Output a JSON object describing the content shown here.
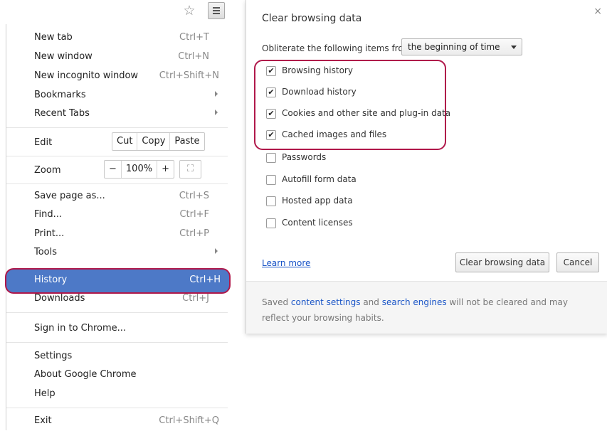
{
  "menu": {
    "items_top": [
      {
        "label": "New tab",
        "shortcut": "Ctrl+T"
      },
      {
        "label": "New window",
        "shortcut": "Ctrl+N"
      },
      {
        "label": "New incognito window",
        "shortcut": "Ctrl+Shift+N"
      },
      {
        "label": "Bookmarks",
        "shortcut": ""
      },
      {
        "label": "Recent Tabs",
        "shortcut": ""
      }
    ],
    "edit": {
      "label": "Edit",
      "cut": "Cut",
      "copy": "Copy",
      "paste": "Paste"
    },
    "zoom": {
      "label": "Zoom",
      "minus": "−",
      "value": "100%",
      "plus": "+",
      "fullscreen": "⛶"
    },
    "items_mid": [
      {
        "label": "Save page as...",
        "shortcut": "Ctrl+S"
      },
      {
        "label": "Find...",
        "shortcut": "Ctrl+F"
      },
      {
        "label": "Print...",
        "shortcut": "Ctrl+P"
      },
      {
        "label": "Tools",
        "shortcut": ""
      }
    ],
    "history": {
      "label": "History",
      "shortcut": "Ctrl+H"
    },
    "downloads": {
      "label": "Downloads",
      "shortcut": "Ctrl+J"
    },
    "signin": {
      "label": "Sign in to Chrome..."
    },
    "settings": {
      "label": "Settings"
    },
    "about": {
      "label": "About Google Chrome"
    },
    "help": {
      "label": "Help"
    },
    "exit": {
      "label": "Exit",
      "shortcut": "Ctrl+Shift+Q"
    }
  },
  "dialog": {
    "title": "Clear browsing data",
    "close": "×",
    "from_label": "Obliterate the following items from:",
    "from_value": "the beginning of time",
    "options": [
      {
        "label": "Browsing history",
        "checked": true
      },
      {
        "label": "Download history",
        "checked": true
      },
      {
        "label": "Cookies and other site and plug-in data",
        "checked": true
      },
      {
        "label": "Cached images and files",
        "checked": true
      },
      {
        "label": "Passwords",
        "checked": false
      },
      {
        "label": "Autofill form data",
        "checked": false
      },
      {
        "label": "Hosted app data",
        "checked": false
      },
      {
        "label": "Content licenses",
        "checked": false
      }
    ],
    "learn_more": "Learn more",
    "clear_button": "Clear browsing data",
    "cancel_button": "Cancel",
    "footer": {
      "pre": "Saved ",
      "link1": "content settings",
      "mid": " and ",
      "link2": "search engines",
      "post": " will not be cleared and may reflect your browsing habits."
    }
  },
  "colors": {
    "highlight": "#4d79c7",
    "annotation": "#b0174a",
    "link": "#1a55c7"
  },
  "icons": {
    "bookmark": "star-icon",
    "menu": "hamburger-icon",
    "check": "checkmark-icon"
  }
}
